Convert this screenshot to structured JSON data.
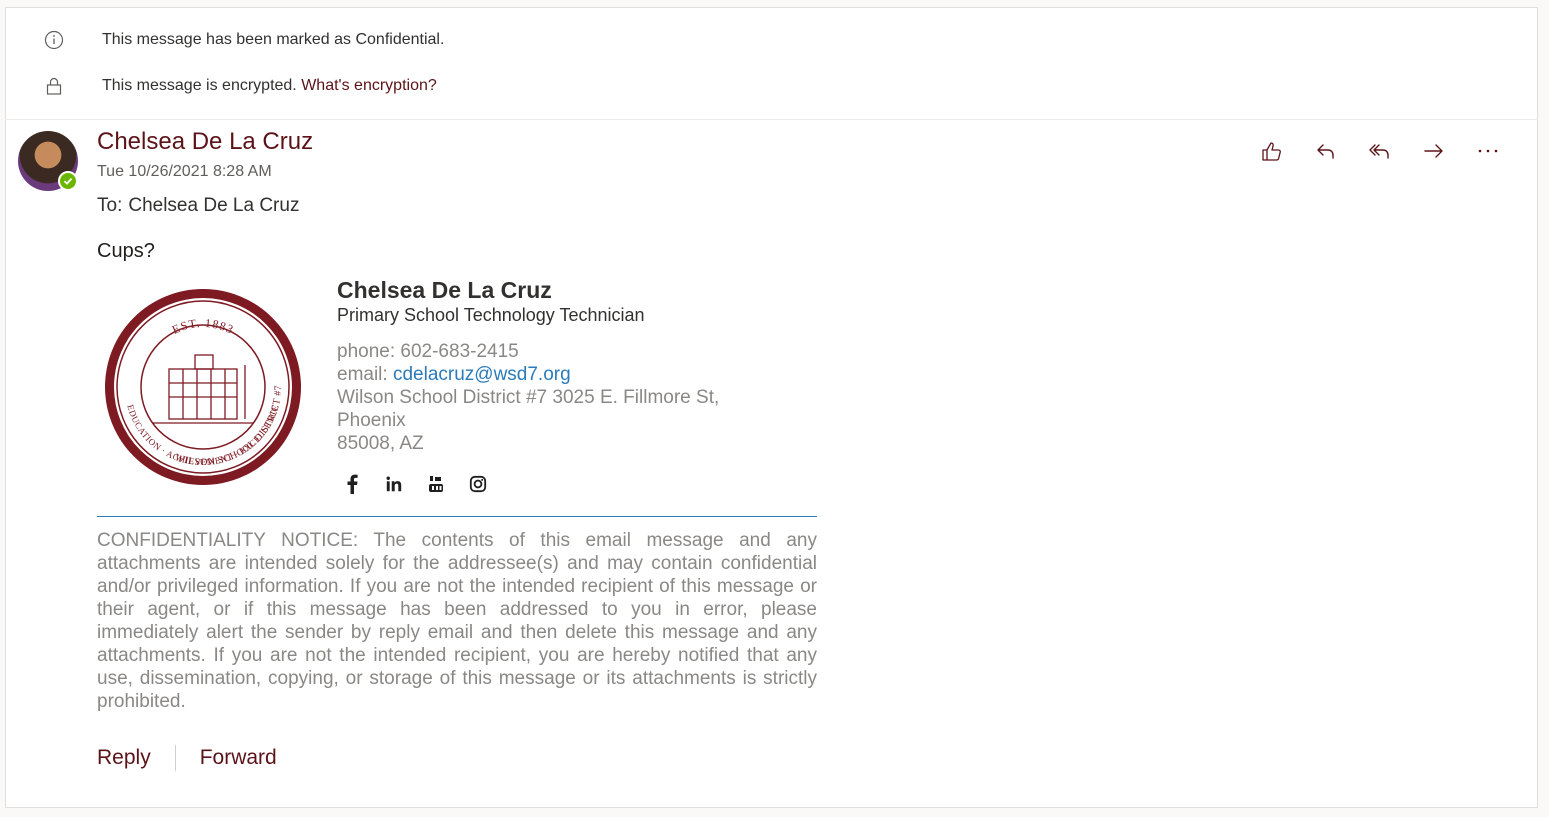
{
  "notices": {
    "confidential": "This message has been marked as Confidential.",
    "encrypted": "This message is encrypted.",
    "encryption_link": "What's encryption?"
  },
  "message": {
    "sender": "Chelsea De La Cruz",
    "date": "Tue 10/26/2021 8:28 AM",
    "to_label": "To:",
    "to_value": "Chelsea De La Cruz",
    "body": "Cups?"
  },
  "signature": {
    "name": "Chelsea De La Cruz",
    "title": "Primary School Technology Technician",
    "phone_label": "phone:",
    "phone": "602-683-2415",
    "email_label": "email:",
    "email": "cdelacruz@wsd7.org",
    "address_line1": "Wilson School District #7 3025 E. Fillmore St,",
    "address_line2": "Phoenix",
    "address_line3": "85008, AZ",
    "seal_text": {
      "est": "EST. 1883",
      "district": "WILSON SCHOOL DISTRICT #7",
      "motto": "EDUCATION · ACHIEVEMENT · EXCELLENCE"
    },
    "social": [
      "facebook-icon",
      "linkedin-icon",
      "youtube-icon",
      "instagram-icon"
    ]
  },
  "confidentiality": "CONFIDENTIALITY NOTICE: The contents of this email message and any attachments are intended solely for the addressee(s) and may contain confidential and/or privileged information. If you are not the intended recipient of this message or their agent, or if this message has been addressed to you in error, please immediately alert the sender by reply email and then delete this message and any attachments. If you are not the intended recipient, you are hereby notified that any use, dissemination, copying, or storage of this message or its attachments is strictly prohibited.",
  "footer": {
    "reply": "Reply",
    "forward": "Forward"
  },
  "colors": {
    "accent": "#5c1318",
    "link": "#2b7bb9",
    "presence": "#6bb700"
  }
}
